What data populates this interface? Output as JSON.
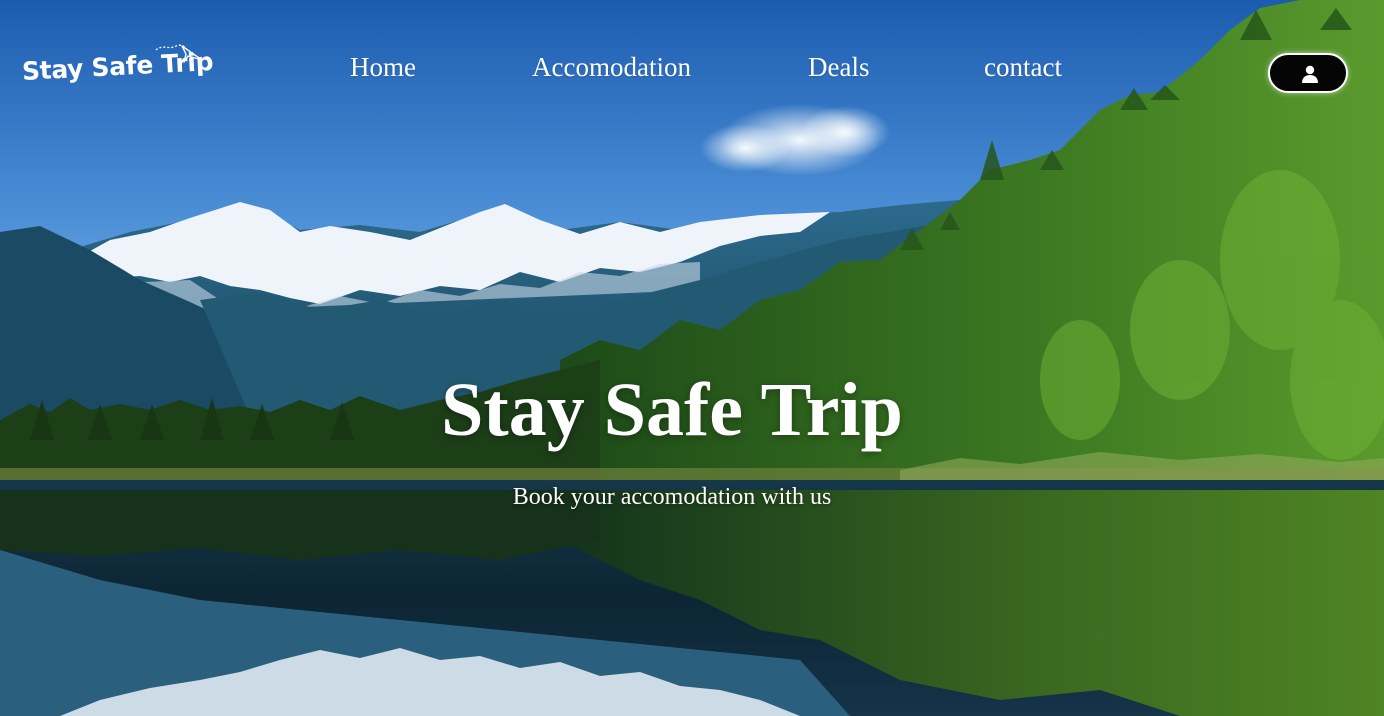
{
  "brand": {
    "logo_text": "Stay Safe Trip"
  },
  "nav": {
    "links": [
      {
        "label": "Home"
      },
      {
        "label": "Accomodation"
      },
      {
        "label": "Deals"
      },
      {
        "label": "contact"
      }
    ],
    "user_icon": "user-icon"
  },
  "hero": {
    "title": "Stay Safe Trip",
    "subtitle": "Book your accomodation with us"
  },
  "colors": {
    "sky_top": "#1f5fb0",
    "sky_bottom": "#8fc3ec",
    "forest": "#2f6a1c",
    "water": "#0f2f3e",
    "text": "#ffffff",
    "button_bg": "#050505"
  }
}
